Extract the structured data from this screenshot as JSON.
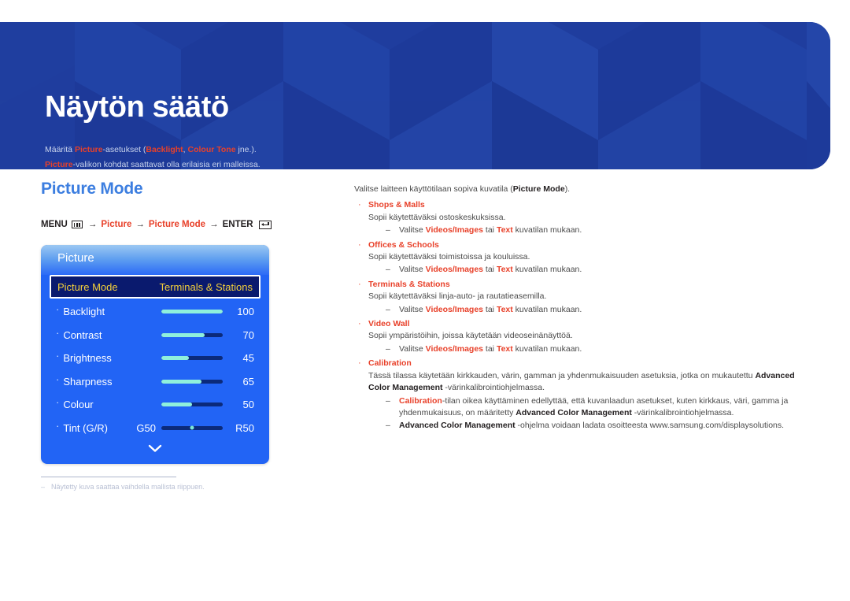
{
  "banner": {
    "title": "Näytön säätö",
    "sub_line1_pre": "Määritä ",
    "sub_line1_hl1": "Picture",
    "sub_line1_mid": "-asetukset (",
    "sub_line1_hl2": "Backlight",
    "sub_line1_mid2": ", ",
    "sub_line1_hl3": "Colour Tone",
    "sub_line1_end": " jne.).",
    "sub_line2_hl": "Picture",
    "sub_line2_end": "-valikon kohdat saattavat olla erilaisia eri malleissa."
  },
  "left": {
    "section_title": "Picture Mode",
    "menupath": {
      "menu_label": "MENU",
      "menu_icon": "menu-grid-icon",
      "arrow": "→",
      "step1": "Picture",
      "step2": "Picture Mode",
      "enter_label": "ENTER",
      "enter_icon": "enter-key-icon"
    },
    "osd": {
      "title": "Picture",
      "selected_row": {
        "label": "Picture Mode",
        "value": "Terminals & Stations"
      },
      "rows": [
        {
          "label": "Backlight",
          "value": "100",
          "fill_pct": 100
        },
        {
          "label": "Contrast",
          "value": "70",
          "fill_pct": 70
        },
        {
          "label": "Brightness",
          "value": "45",
          "fill_pct": 45
        },
        {
          "label": "Sharpness",
          "value": "65",
          "fill_pct": 65
        },
        {
          "label": "Colour",
          "value": "50",
          "fill_pct": 50
        }
      ],
      "tint_row": {
        "label": "Tint (G/R)",
        "left_value": "G50",
        "right_value": "R50",
        "knob_pct": 50
      },
      "more_icon": "chevron-down-icon"
    },
    "footnote": {
      "dash": "–",
      "text": "Näytetty kuva saattaa vaihdella mallista riippuen."
    }
  },
  "right": {
    "intro_pre": "Valitse laitteen käyttötilaan sopiva kuvatila (",
    "intro_bold": "Picture Mode",
    "intro_post": ").",
    "bullet_mark": "·",
    "sub_mark": "–",
    "items": [
      {
        "title": "Shops & Malls",
        "desc": "Sopii käytettäväksi ostoskeskuksissa.",
        "sub_pre": "Valitse ",
        "sub_b1": "Videos/Images",
        "sub_mid": " tai ",
        "sub_b2": "Text",
        "sub_post": " kuvatilan mukaan."
      },
      {
        "title": "Offices & Schools",
        "desc": "Sopii käytettäväksi toimistoissa ja kouluissa.",
        "sub_pre": "Valitse ",
        "sub_b1": "Videos/Images",
        "sub_mid": " tai ",
        "sub_b2": "Text",
        "sub_post": " kuvatilan mukaan."
      },
      {
        "title": "Terminals & Stations",
        "desc": "Sopii käytettäväksi linja-auto- ja rautatieasemilla.",
        "sub_pre": "Valitse ",
        "sub_b1": "Videos/Images",
        "sub_mid": " tai ",
        "sub_b2": "Text",
        "sub_post": " kuvatilan mukaan."
      },
      {
        "title": "Video Wall",
        "desc": "Sopii ympäristöihin, joissa käytetään videoseinänäyttöä.",
        "sub_pre": "Valitse ",
        "sub_b1": "Videos/Images",
        "sub_mid": " tai ",
        "sub_b2": "Text",
        "sub_post": " kuvatilan mukaan."
      }
    ],
    "calibration": {
      "title": "Calibration",
      "desc_pre": "Tässä tilassa käytetään kirkkauden, värin, gamman ja yhdenmukaisuuden asetuksia, jotka on mukautettu ",
      "desc_bold": "Advanced Color Management",
      "desc_post": " -värinkalibrointiohjelmassa.",
      "sub1_red": "Calibration",
      "sub1_mid": "-tilan oikea käyttäminen edellyttää, että kuvanlaadun asetukset, kuten kirkkaus, väri, gamma ja yhdenmukaisuus, on määritetty ",
      "sub1_bold": "Advanced Color Management",
      "sub1_post": " -värinkalibrointiohjelmassa.",
      "sub2_bold": "Advanced Color Management",
      "sub2_post": " -ohjelma voidaan ladata osoitteesta www.samsung.com/displaysolutions."
    }
  },
  "colors": {
    "banner_blue": "#1f3d9e",
    "accent_red": "#e8412a",
    "section_blue": "#3c7ee0",
    "osd_blue": "#2264f5",
    "osd_selected": "#0a1a6e",
    "osd_gold": "#f6d13a",
    "slider_fill": "#8ff0dc"
  }
}
